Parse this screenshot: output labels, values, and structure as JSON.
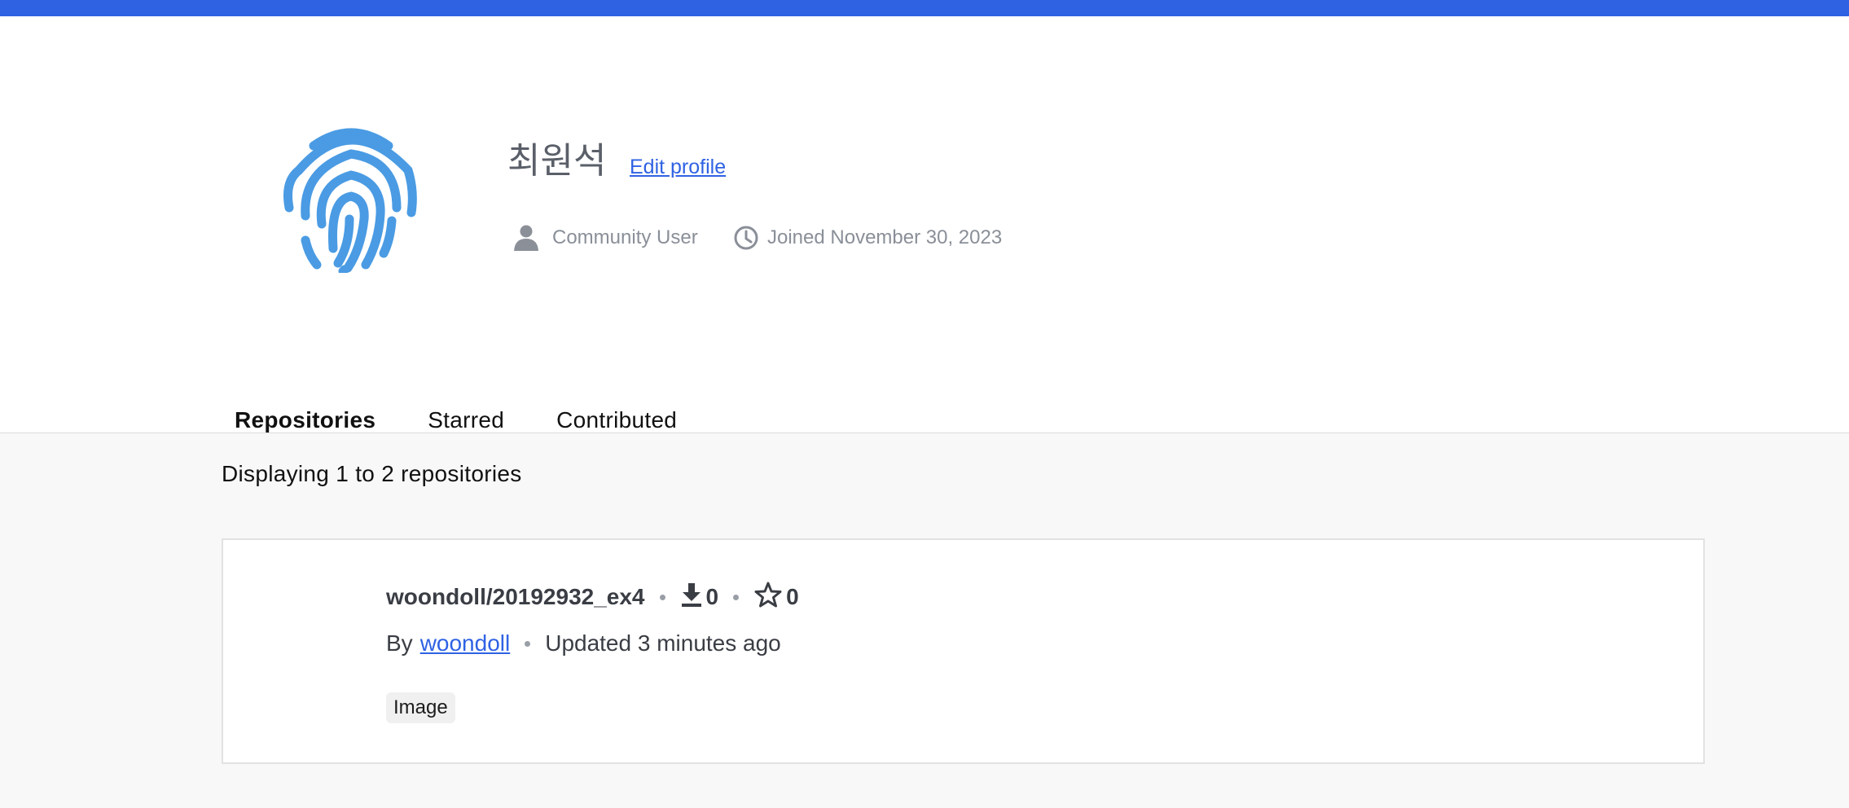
{
  "profile": {
    "display_name": "최원석",
    "edit_label": "Edit profile",
    "role": "Community User",
    "joined": "Joined November 30, 2023",
    "avatar_icon": "fingerprint-icon"
  },
  "tabs": [
    {
      "label": "Repositories",
      "active": true
    },
    {
      "label": "Starred",
      "active": false
    },
    {
      "label": "Contributed",
      "active": false
    }
  ],
  "listing": {
    "count_text": "Displaying 1 to 2 repositories"
  },
  "repo": {
    "name": "woondoll/20192932_ex4",
    "downloads": "0",
    "stars": "0",
    "by_prefix": "By",
    "owner": "woondoll",
    "updated": "Updated 3 minutes ago",
    "tag": "Image"
  },
  "colors": {
    "accent": "#2f62e3",
    "avatar": "#4a9be3",
    "muted_text": "#8a8f98"
  }
}
